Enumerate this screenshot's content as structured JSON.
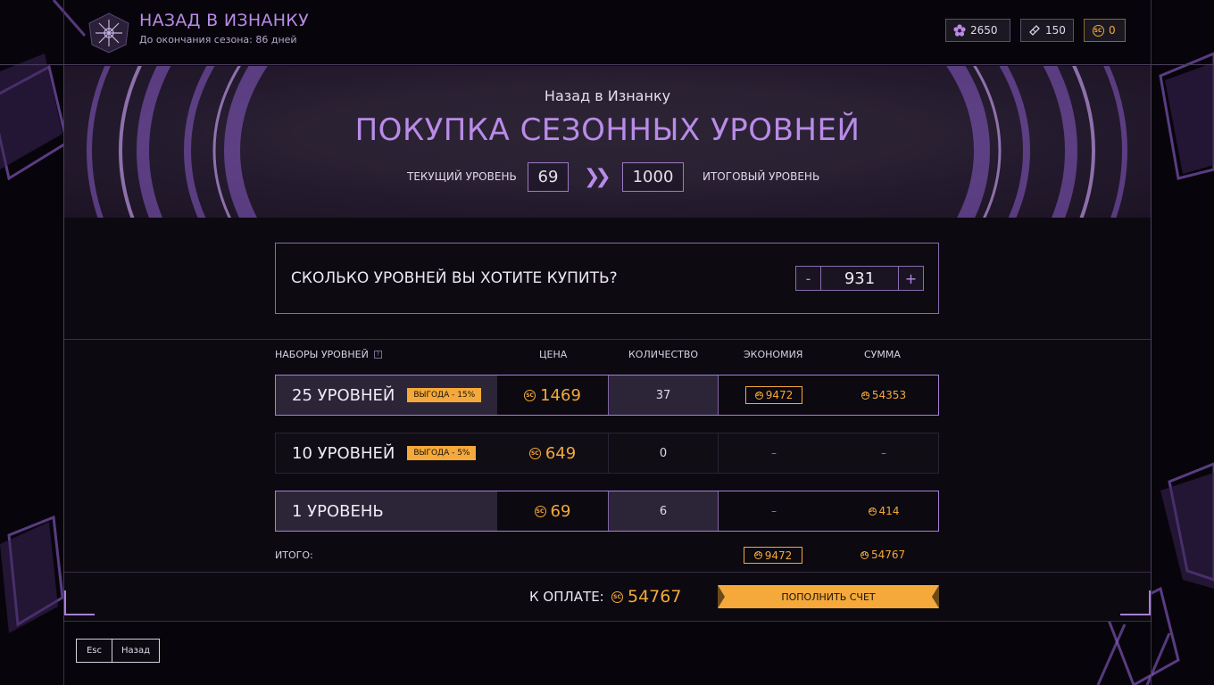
{
  "header": {
    "title": "НАЗАД В ИЗНАНКУ",
    "subtitle": "До окончания сезона: 86 дней",
    "currencies": [
      {
        "icon": "flower-crystal-icon",
        "value": "2650"
      },
      {
        "icon": "ticket-icon",
        "value": "150"
      },
      {
        "icon": "sc-coin-icon",
        "value": "0"
      }
    ]
  },
  "banner": {
    "subtitle": "Назад в Изнанку",
    "title": "ПОКУПКА СЕЗОННЫХ УРОВНЕЙ",
    "current_label": "ТЕКУЩИЙ УРОВЕНЬ",
    "current_value": "69",
    "target_value": "1000",
    "target_label": "ИТОГОВЫЙ УРОВЕНЬ"
  },
  "purchase": {
    "question": "СКОЛЬКО УРОВНЕЙ ВЫ ХОТИТЕ КУПИТЬ?",
    "minus": "-",
    "plus": "+",
    "amount": "931"
  },
  "table": {
    "headers": {
      "bundles": "НАБОРЫ УРОВНЕЙ",
      "help": "?",
      "price": "ЦЕНА",
      "quantity": "КОЛИЧЕСТВО",
      "savings": "ЭКОНОМИЯ",
      "sum": "СУММА"
    },
    "rows": [
      {
        "name": "25 УРОВНЕЙ",
        "badge": "ВЫГОДА - 15%",
        "price": "1469",
        "quantity": "37",
        "savings": "9472",
        "sum": "54353"
      },
      {
        "name": "10 УРОВНЕЙ",
        "badge": "ВЫГОДА - 5%",
        "price": "649",
        "quantity": "0",
        "savings": "–",
        "sum": "–"
      },
      {
        "name": "1 УРОВЕНЬ",
        "price": "69",
        "quantity": "6",
        "savings": "–",
        "sum": "414"
      }
    ],
    "total_label": "ИТОГО:",
    "total_savings": "9472",
    "total_sum": "54767"
  },
  "payment": {
    "label": "К ОПЛАТЕ:",
    "amount": "54767",
    "button": "ПОПОЛНИТЬ СЧЕТ"
  },
  "footer": {
    "esc_key": "Esc",
    "back_label": "Назад"
  },
  "colors": {
    "accent_purple": "#b98be8",
    "accent_gold": "#f4a93a",
    "background": "#07050b"
  }
}
